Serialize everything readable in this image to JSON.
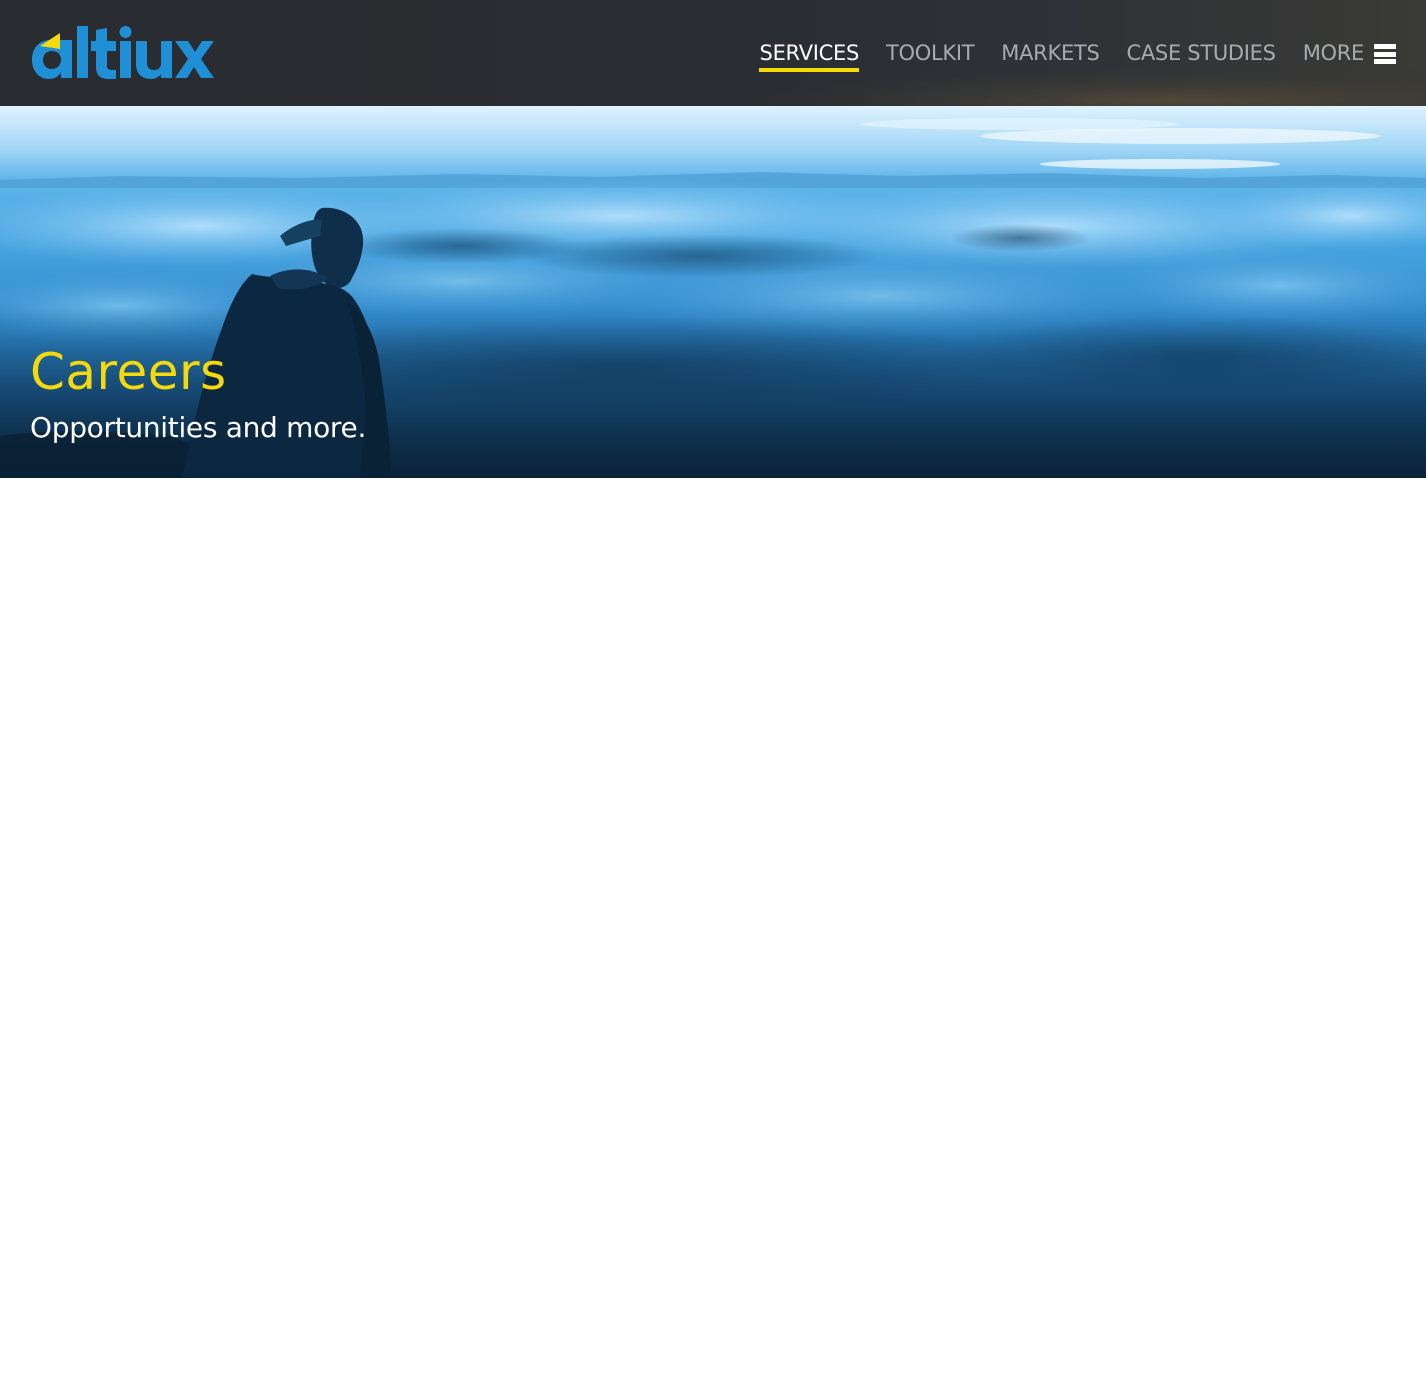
{
  "brand": {
    "logo_text": "altiux",
    "colors": {
      "logo_blue": "#1f8fd6",
      "logo_yellow": "#f5d90a",
      "header_bg": "#2a2d31",
      "accent_yellow": "#f5d90a"
    }
  },
  "nav": {
    "items": [
      {
        "label": "SERVICES",
        "active": true
      },
      {
        "label": "TOOLKIT",
        "active": false
      },
      {
        "label": "MARKETS",
        "active": false
      },
      {
        "label": "CASE STUDIES",
        "active": false
      }
    ],
    "more_label": "MORE",
    "more_icon": "hamburger-menu-icon"
  },
  "hero": {
    "title": "Careers",
    "subtitle": "Opportunities and more.",
    "image": "person-overlooking-sea-of-clouds"
  }
}
